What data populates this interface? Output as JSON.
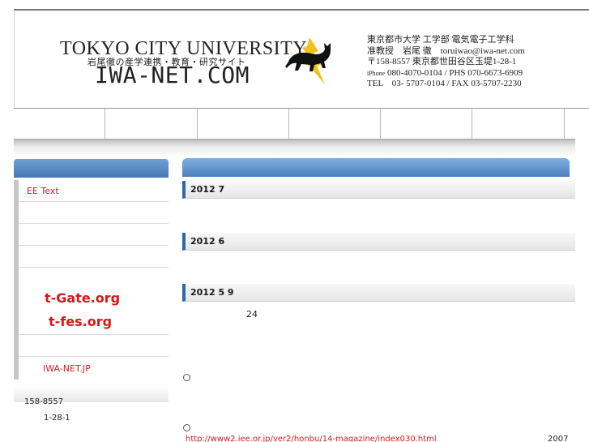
{
  "header": {
    "university": "TOKYO CITY UNIVERSITY",
    "subtitle": "岩尾徹の産学連携・教育・研究サイト",
    "site_name": "IWA-NET.COM",
    "contact_lines": [
      "東京都市大学 工学部 電気電子工学科",
      "准教授　岩尾 徹　toruiwao@iwa-net.com",
      "〒158-8557 東京都世田谷区玉堤1-28-1"
    ],
    "phone_prefix": "iPhone",
    "phone_line": " 080-4070-0104 / PHS 070-6673-6909",
    "tel_line": "TEL　03- 5707-0104 / FAX 03-5707-2230",
    "logo_icon": "cat-lightning-icon",
    "colors": {
      "cat": "#111111",
      "lightning": "#f2c21b"
    }
  },
  "nav": {
    "cells": [
      "",
      "",
      "",
      "",
      "",
      "",
      ""
    ]
  },
  "sidebar": {
    "items": [
      {
        "label": "EE Text",
        "color": "#d01c1c"
      },
      {
        "label": ""
      },
      {
        "label": ""
      },
      {
        "label": ""
      },
      {
        "label": "t-Gate.org",
        "color": "#d61818"
      },
      {
        "label": "t-fes.org",
        "color": "#d61818"
      },
      {
        "label": ""
      },
      {
        "label": "IWA-NET.JP",
        "color": "#d41e1e"
      }
    ],
    "address_zip": "158-8557",
    "address_street": "1-28-1"
  },
  "main": {
    "news": [
      {
        "date": "2012  7"
      },
      {
        "date": "2012  6"
      },
      {
        "date": "2012  5  9",
        "body": "24"
      }
    ],
    "link": "http://www2.iee.or.jp/ver2/honbu/14-magazine/index030.html",
    "year": "2007",
    "accent": "#2f67a9"
  }
}
